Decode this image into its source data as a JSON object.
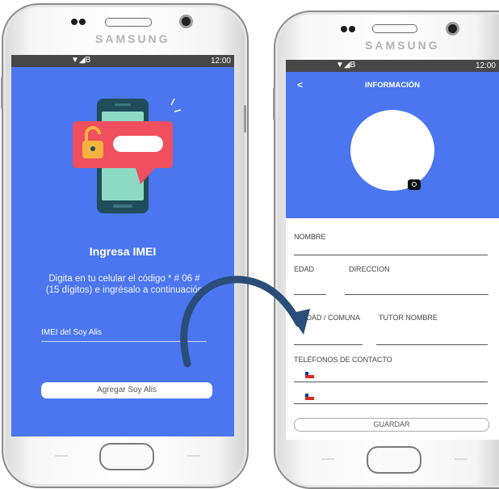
{
  "phones": [
    {
      "brand": "SAMSUNG",
      "status_time": "12:00",
      "status_signal": "▼◢B"
    },
    {
      "brand": "SAMSUNG",
      "status_time": "12:00",
      "status_signal": "▼◢B"
    }
  ],
  "imei_screen": {
    "title": "Ingresa IMEI",
    "description_line1": "Digita en tu celular el código * # 06 #",
    "description_line2": "(15 dígitos) e ingrésalo a continuación",
    "input_label": "IMEI del Soy Alis",
    "button_label": "Agregar Soy Alis"
  },
  "info_screen": {
    "back_glyph": "<",
    "title": "INFORMACIÓN",
    "fields": {
      "nombre": "NOMBRE",
      "edad": "EDAD",
      "direccion": "DIRECCION",
      "ciudad": "CIUDAD / COMUNA",
      "tutor": "TUTOR NOMBRE",
      "telefonos": "TELÉFONOS DE CONTACTO"
    },
    "save_label": "GUARDAR"
  },
  "colors": {
    "screen_blue": "#4b76f0",
    "status_bar": "#474747",
    "arrow": "#2a4d79",
    "lock_red": "#ef4f5e",
    "phone_illustration": "#1f4d5a"
  }
}
